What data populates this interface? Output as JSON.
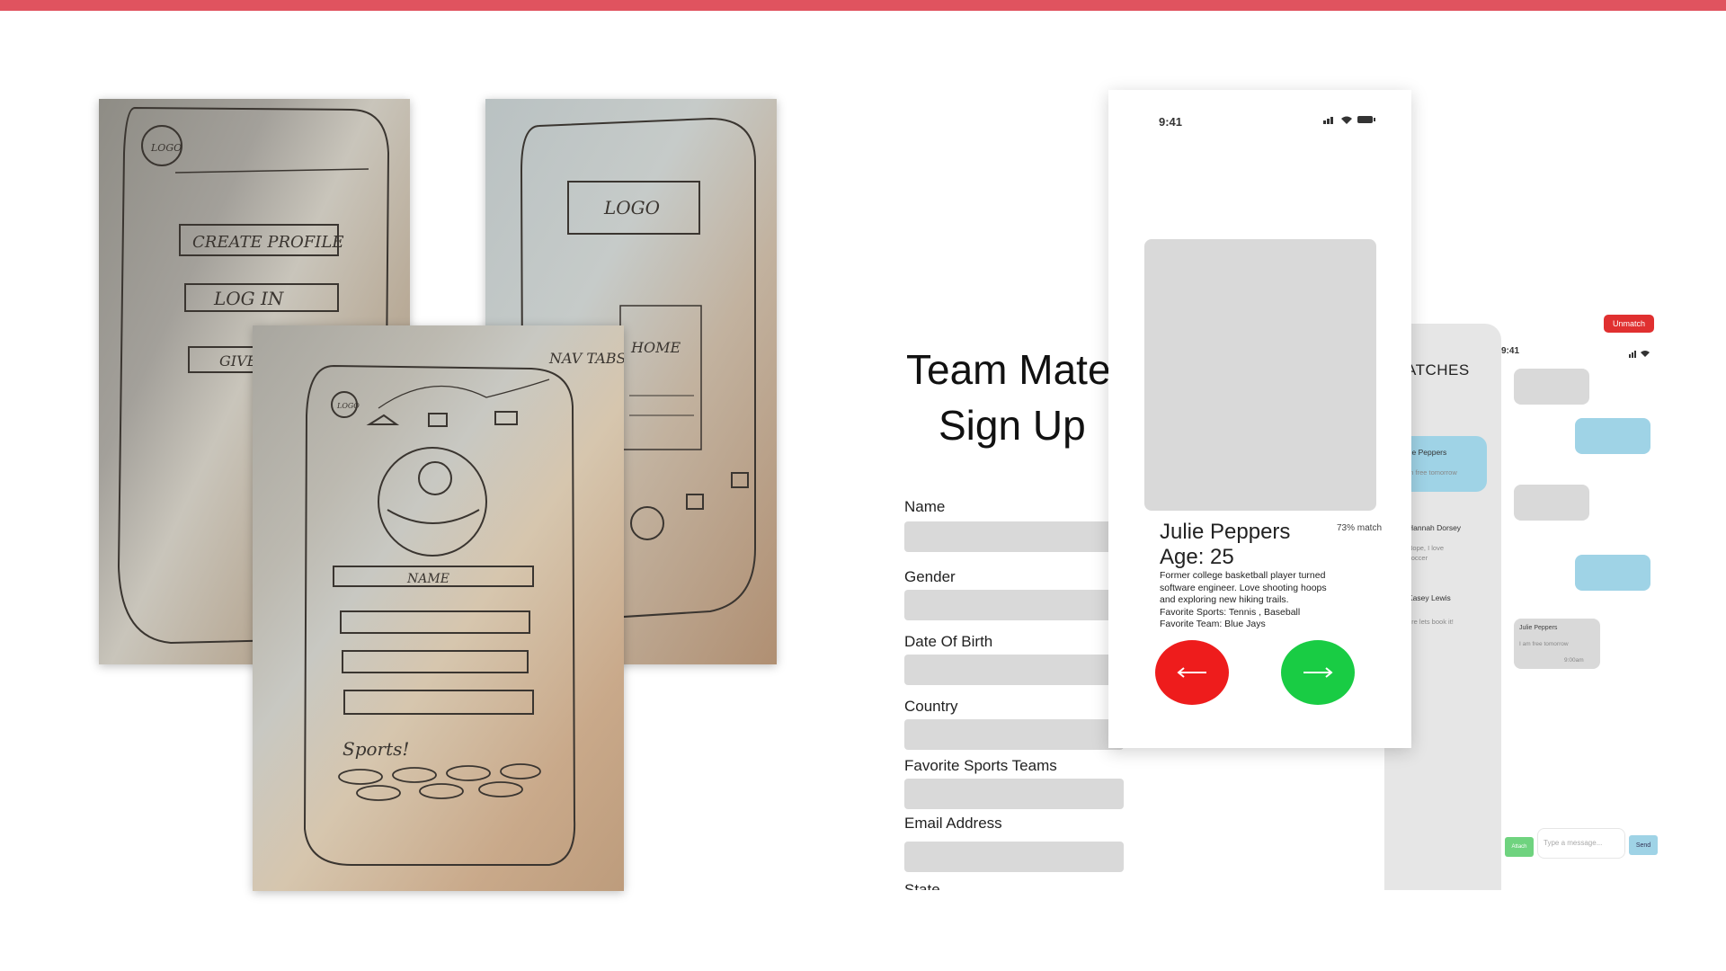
{
  "colors": {
    "accent_bar": "#e0535f",
    "reject": "#ee1c1c",
    "accept": "#19cc44",
    "bubble_blue": "#9fd3e6",
    "unmatch": "#e03030"
  },
  "sketches": {
    "sketch1": {
      "logo": "LOGO",
      "create_profile": "CREATE PROFILE",
      "log_in": "LOG IN",
      "third": "GIVE"
    },
    "sketch2": {
      "logo": "LOGO",
      "home": "HOME"
    },
    "sketch3": {
      "logo": "LOGO",
      "nav_tabs": "NAV TABS?",
      "name": "NAME",
      "sports": "Sports!"
    }
  },
  "signup": {
    "title_line1": "Team Mate",
    "title_line2": "Sign Up",
    "fields": [
      "Name",
      "Gender",
      "Date Of Birth",
      "Country",
      "Favorite Sports Teams",
      "Email Address",
      "State"
    ]
  },
  "profile": {
    "time": "9:41",
    "name": "Julie Peppers",
    "age": "Age: 25",
    "match": "73% match",
    "bio": [
      "Former college basketball player turned",
      "software engineer. Love shooting hoops",
      "and exploring new hiking trails.",
      "Favorite Sports: Tennis , Baseball",
      "Favorite Team: Blue Jays"
    ],
    "reject_icon": "arrow-left-icon",
    "accept_icon": "arrow-right-icon"
  },
  "matches": {
    "title": "ATCHES",
    "items": [
      {
        "name": "ulie Peppers",
        "preview": "am free tomorrow"
      },
      {
        "name": "Hannah Dorsey",
        "preview": "Nope, I love\nsoccer"
      },
      {
        "name": "Kasey Lewis",
        "preview": "ure lets book it!"
      }
    ]
  },
  "chat": {
    "time": "9:41",
    "unmatch": "Unmatch",
    "card_name": "Julie Peppers",
    "card_msg": "I am free tomorrow",
    "card_status": "9:00am",
    "input_placeholder": "Type a message...",
    "send": "Send",
    "attach": "Attach"
  }
}
